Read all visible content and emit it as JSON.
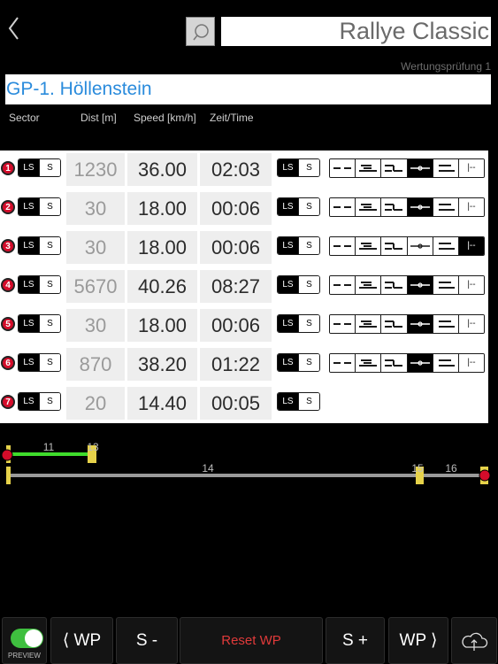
{
  "header": {
    "title": "Rallye Classic",
    "subtitle": "Wertungsprüfung 1",
    "stage_name": "GP-1. Höllenstein",
    "icons": {
      "back": "chevron-left-icon",
      "search": "search-icon"
    }
  },
  "columns": {
    "sector": "Sector",
    "dist": "Dist [m]",
    "speed": "Speed [km/h]",
    "time": "Zeit/Time"
  },
  "toggle_labels": {
    "ls": "LS",
    "s": "S"
  },
  "mode_labels": {
    "last": "|--"
  },
  "rows": [
    {
      "num": "1",
      "dist": "1230",
      "speed": "36.00",
      "time": "02:03",
      "left_toggle": "LS",
      "right_toggle": "LS",
      "mode": 3
    },
    {
      "num": "2",
      "dist": "30",
      "speed": "18.00",
      "time": "00:06",
      "left_toggle": "LS",
      "right_toggle": "LS",
      "mode": 3
    },
    {
      "num": "3",
      "dist": "30",
      "speed": "18.00",
      "time": "00:06",
      "left_toggle": "LS",
      "right_toggle": "LS",
      "mode": 5
    },
    {
      "num": "4",
      "dist": "5670",
      "speed": "40.26",
      "time": "08:27",
      "left_toggle": "LS",
      "right_toggle": "LS",
      "mode": 3
    },
    {
      "num": "5",
      "dist": "30",
      "speed": "18.00",
      "time": "00:06",
      "left_toggle": "LS",
      "right_toggle": "LS",
      "mode": 3
    },
    {
      "num": "6",
      "dist": "870",
      "speed": "38.20",
      "time": "01:22",
      "left_toggle": "LS",
      "right_toggle": "LS",
      "mode": 3
    },
    {
      "num": "7",
      "dist": "20",
      "speed": "14.40",
      "time": "00:05",
      "left_toggle": "LS",
      "right_toggle": "LS",
      "mode": null
    }
  ],
  "timeline": {
    "labels": [
      "11",
      "13",
      "14",
      "15",
      "16"
    ],
    "colors": {
      "active": "#3fdc2c",
      "track": "#9a9a9a",
      "marker": "#e6d24a",
      "start": "#d40c2a"
    }
  },
  "bottom": {
    "preview": "PREVIEW",
    "prev_wp": "⟨ WP",
    "s_minus": "S -",
    "reset": "Reset WP",
    "s_plus": "S +",
    "next_wp": "WP ⟩",
    "cloud_icon": "cloud-upload-icon"
  }
}
